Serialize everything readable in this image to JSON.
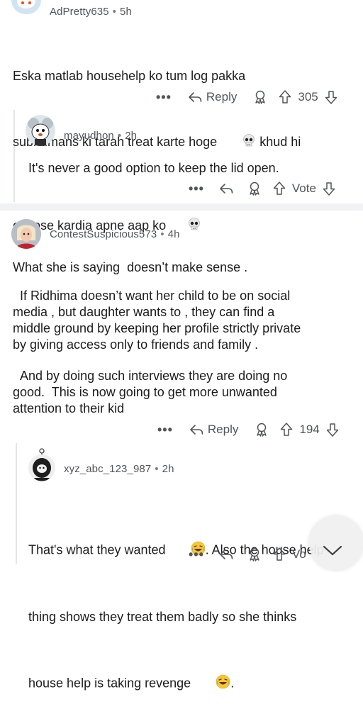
{
  "comments": [
    {
      "username": "AdPretty635",
      "age": "5h",
      "line1": "Eska matlab househelp ko tum log pakka",
      "line2_a": "subhumans ki tarah treat karte hoge ",
      "line2_b": " khud hi",
      "line3": "expose kardia apne aap ko",
      "reply_label": "Reply",
      "votes": "305"
    },
    {
      "username": "mayudhon",
      "age": "2h",
      "text": "It's never a good option to keep the lid open.",
      "vote_label": "Vote"
    },
    {
      "username": "ContestSuspicious573",
      "age": "4h",
      "para1": "What she is saying  doesn’t make sense .",
      "para2": "  If Ridhima doesn’t want her child to be on social\nmedia , but daughter wants to , they can find a\nmiddle ground by keeping her profile strictly private\nby giving access only to friends and family .",
      "para3": "  And by doing such interviews they are doing no\ngood.  This is now going to get more unwanted\nattention to their kid",
      "reply_label": "Reply",
      "votes": "194"
    },
    {
      "username": "xyz_abc_123_987",
      "age": "2h",
      "line1_a": "That's what they wanted ",
      "line1_b": ". Also the house help",
      "line2": "thing shows they treat them badly so she thinks",
      "line3_a": "house help is taking revenge ",
      "line3_b": ".",
      "vote_label_partial": "Vo"
    }
  ],
  "separator_dot": "•",
  "more_label": "•••",
  "colors": {
    "text": "#1c1c1c",
    "meta": "#4f5559",
    "thread_line": "#e3e6e8",
    "separator": "#f1f2f4"
  },
  "icons": [
    "reply-arrow-icon",
    "award-icon",
    "upvote-icon",
    "downvote-icon",
    "skull-emoji",
    "laughing-emoji",
    "chevron-down-icon"
  ]
}
